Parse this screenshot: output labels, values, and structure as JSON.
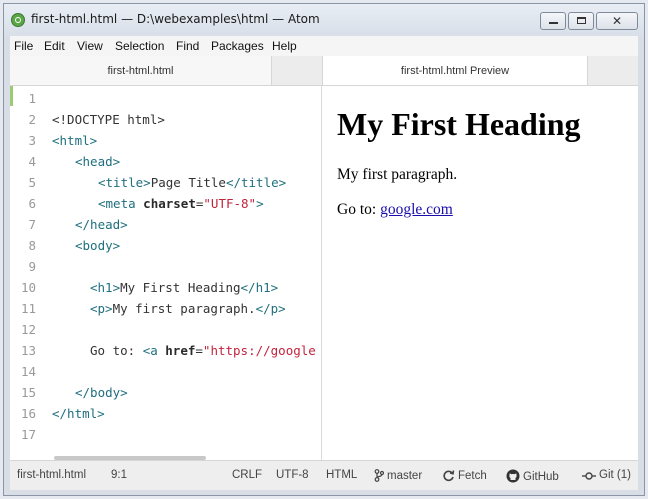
{
  "window": {
    "title": "first-html.html — D:\\webexamples\\html — Atom",
    "close_glyph": "✕"
  },
  "menu": [
    "File",
    "Edit",
    "View",
    "Selection",
    "Find",
    "Packages",
    "Help"
  ],
  "tabs": [
    {
      "label": "first-html.html"
    },
    {
      "label": "first-html.html Preview"
    }
  ],
  "editor": {
    "line_numbers": [
      "1",
      "2",
      "3",
      "4",
      "5",
      "6",
      "7",
      "8",
      "9",
      "10",
      "11",
      "12",
      "13",
      "14",
      "15",
      "16",
      "17"
    ],
    "lines": {
      "l2": "<!DOCTYPE html>",
      "l3": "<html>",
      "l4": "<head>",
      "l5": {
        "open": "<title>",
        "text": "Page Title",
        "close": "</title>"
      },
      "l6": {
        "open": "<meta",
        "attr": "charset",
        "eq": "=",
        "value": "\"UTF-8\"",
        "end": ">"
      },
      "l7": "</head>",
      "l8": "<body>",
      "l10": {
        "open": "<h1>",
        "text": "My First Heading",
        "close": "</h1>"
      },
      "l11": {
        "open": "<p>",
        "text": "My first paragraph.",
        "close": "</p>"
      },
      "l13": {
        "text": "Go to: ",
        "open": "<a",
        "attr": "href",
        "eq": "=",
        "value": "\"https://google"
      },
      "l15": "</body>",
      "l16": "</html>"
    }
  },
  "preview": {
    "heading": "My First Heading",
    "paragraph": "My first paragraph.",
    "goto_label": "Go to: ",
    "link_text": "google.com"
  },
  "status": {
    "file": "first-html.html",
    "cursor": "9:1",
    "line_ending": "CRLF",
    "encoding": "UTF-8",
    "grammar": "HTML",
    "branch": "master",
    "fetch": "Fetch",
    "github": "GitHub",
    "git": "Git (1)"
  }
}
